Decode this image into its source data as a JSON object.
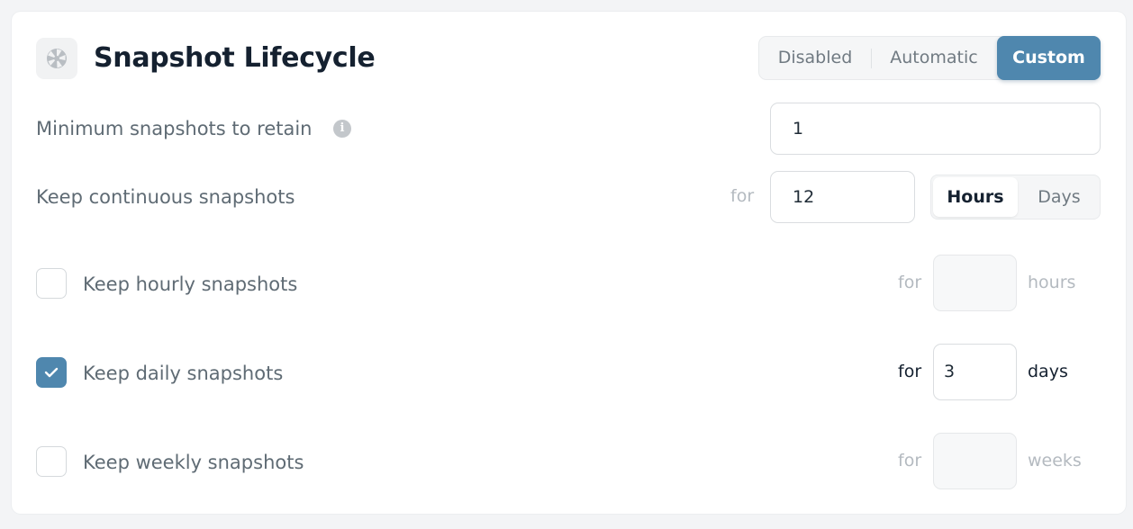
{
  "header": {
    "title": "Snapshot Lifecycle",
    "icon": "aperture-icon",
    "mode_options": [
      "Disabled",
      "Automatic",
      "Custom"
    ],
    "selected_mode": "Custom"
  },
  "colors": {
    "accent": "#4f87ae",
    "title": "#152130",
    "label": "#5f6b74",
    "muted": "#b4bac0"
  },
  "min_retain": {
    "label": "Minimum snapshots to retain",
    "info_icon": "info-icon",
    "value": "1"
  },
  "continuous": {
    "label": "Keep continuous snapshots",
    "for_text": "for",
    "value": "12",
    "unit_options": [
      "Hours",
      "Days"
    ],
    "selected_unit": "Hours"
  },
  "hourly": {
    "label": "Keep hourly snapshots",
    "checked": false,
    "for_text": "for",
    "value": "",
    "unit": "hours"
  },
  "daily": {
    "label": "Keep daily snapshots",
    "checked": true,
    "for_text": "for",
    "value": "3",
    "unit": "days"
  },
  "weekly": {
    "label": "Keep weekly snapshots",
    "checked": false,
    "for_text": "for",
    "value": "",
    "unit": "weeks"
  }
}
